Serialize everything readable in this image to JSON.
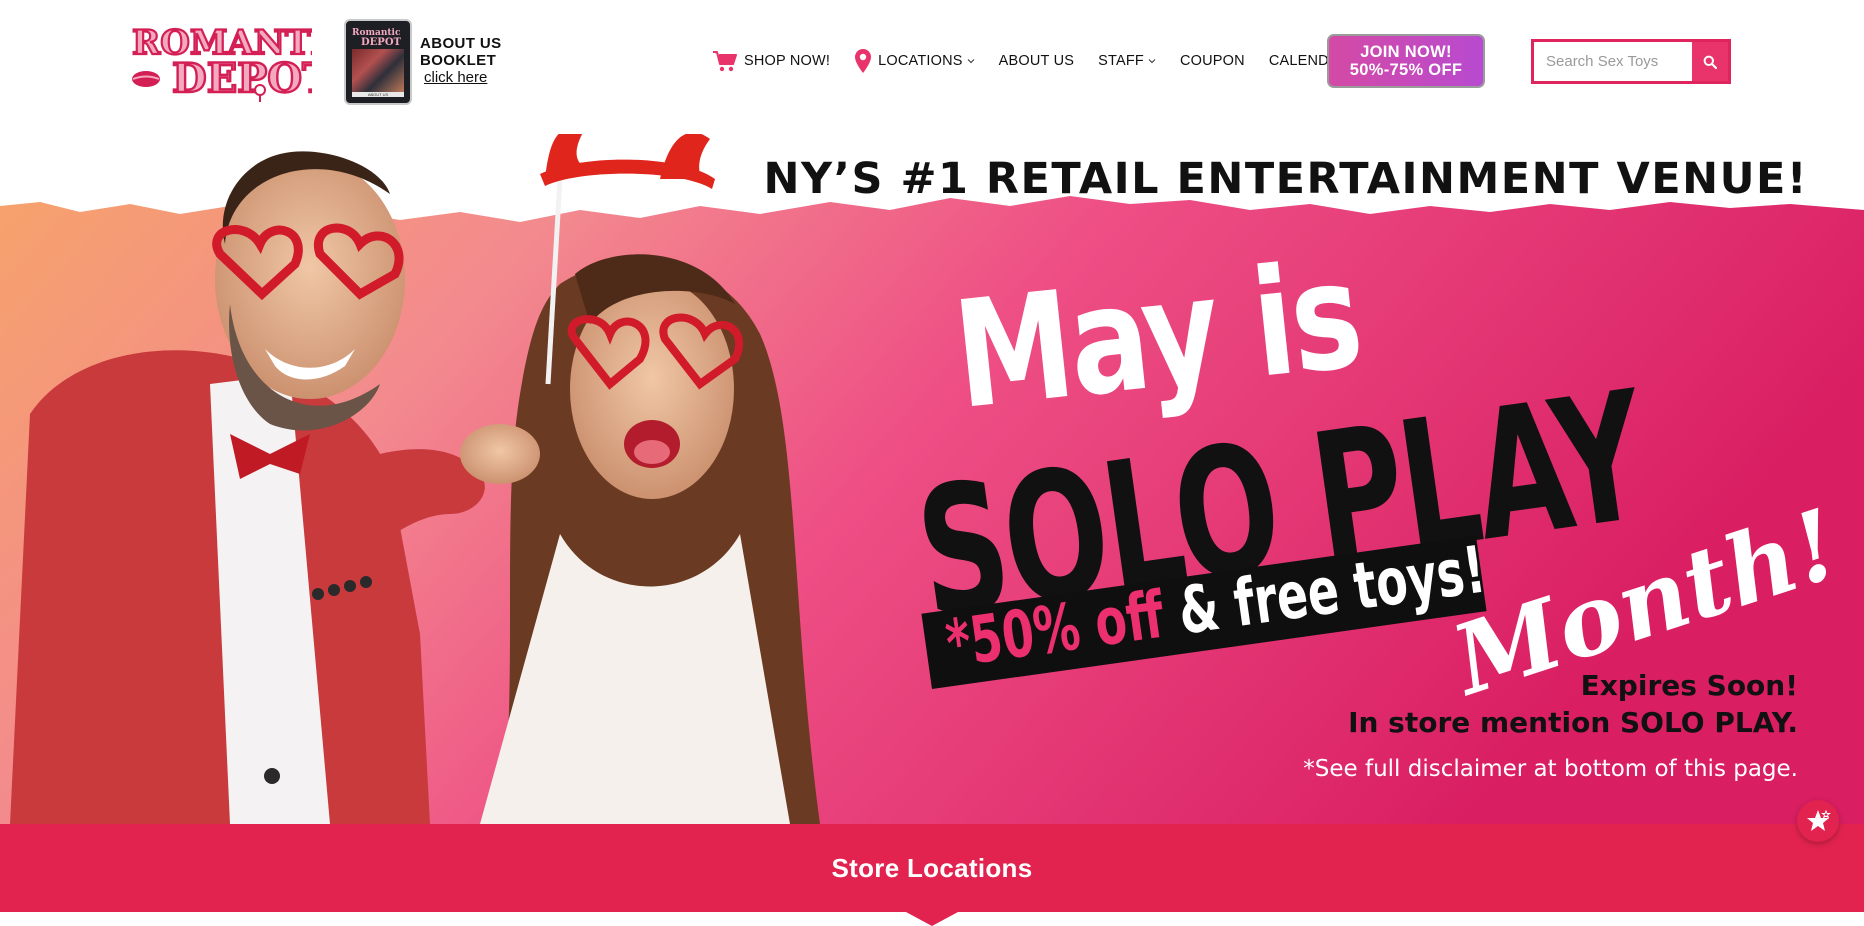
{
  "brand": {
    "logo_line1": "ROMANTIC",
    "logo_line2": "DEPOT",
    "accent": "#e2234f"
  },
  "header": {
    "booklet": {
      "line1": "ABOUT US",
      "line2": "BOOKLET",
      "link": "click here",
      "cover_logo_line1": "Romantic",
      "cover_logo_line2": "DEPOT",
      "cover_strip": "ABOUT US"
    },
    "nav": [
      {
        "label": "SHOP NOW!",
        "icon": "cart-icon"
      },
      {
        "label": "LOCATIONS",
        "icon": "map-pin-icon",
        "dropdown": true
      },
      {
        "label": "ABOUT US"
      },
      {
        "label": "STAFF",
        "dropdown": true
      },
      {
        "label": "COUPON"
      },
      {
        "label": "CALENDAR"
      }
    ],
    "join": {
      "line1": "JOIN NOW!",
      "line2": "50%-75% OFF"
    },
    "search": {
      "placeholder": "Search Sex Toys",
      "value": "",
      "icon": "search-icon"
    }
  },
  "hero": {
    "headline": "NY’S #1 RETAIL ENTERTAINMENT VENUE!",
    "may_is": "May is",
    "solo_play": "SOLO PLAY",
    "month": "Month!",
    "promo_pink": "*50% off",
    "promo_white": " & free toys!",
    "expires": "Expires Soon!",
    "mention": "In store mention SOLO PLAY.",
    "disclaimer": "*See full disclaimer at bottom of this page.",
    "colors": {
      "pink": "#ec4a85",
      "peach": "#f6a26c",
      "dark_pink": "#d91e62"
    }
  },
  "locations": {
    "title": "Store Locations"
  },
  "fab": {
    "icon": "star-icon"
  }
}
